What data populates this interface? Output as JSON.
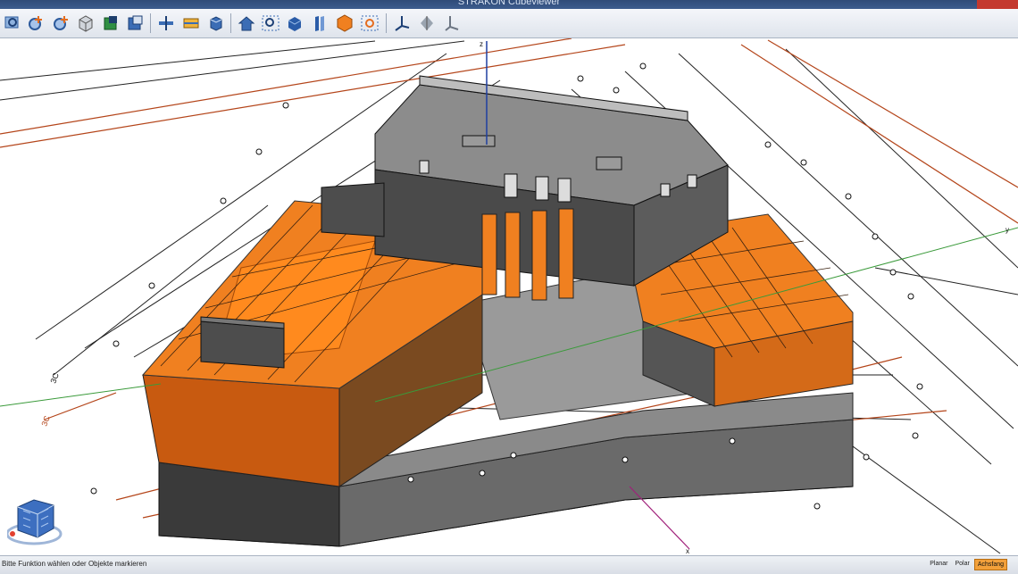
{
  "window": {
    "title": "STRAKON Cubeviewer"
  },
  "toolbar": {
    "buttons": [
      {
        "icon": "zoom-window-icon"
      },
      {
        "icon": "zoom-plus-icon"
      },
      {
        "icon": "zoom-plus-alt-icon"
      },
      {
        "icon": "cube-outline-icon"
      },
      {
        "icon": "green-cube-icon"
      },
      {
        "icon": "layers-icon"
      },
      {
        "icon": "section-plane-icon"
      },
      {
        "icon": "clip-box-icon"
      },
      {
        "icon": "isometric-box-icon"
      },
      {
        "icon": "home-icon"
      },
      {
        "icon": "zoom-fit-icon"
      },
      {
        "icon": "blue-cube-icon"
      },
      {
        "icon": "slice-icon"
      },
      {
        "icon": "orange-hexagon-icon"
      },
      {
        "icon": "zoom-extents-icon"
      },
      {
        "icon": "axis-icon"
      },
      {
        "icon": "gizmo-icon"
      },
      {
        "icon": "axis-alt-icon"
      }
    ]
  },
  "viewport": {
    "axis_z": "z",
    "axis_x": "x",
    "axis_y": "y",
    "label_a": "3C",
    "label_b": "3C"
  },
  "status": {
    "message": "Bitte Funktion wählen oder Objekte markieren",
    "modes": [
      {
        "label": "Planar",
        "active": false
      },
      {
        "label": "Polar",
        "active": false
      },
      {
        "label": "Achsfang",
        "active": true
      }
    ]
  },
  "colors": {
    "accent_orange": "#f08020",
    "dim_red": "#b4451a",
    "concrete": "#6e6e6e",
    "titlebar": "#2f4b78"
  }
}
